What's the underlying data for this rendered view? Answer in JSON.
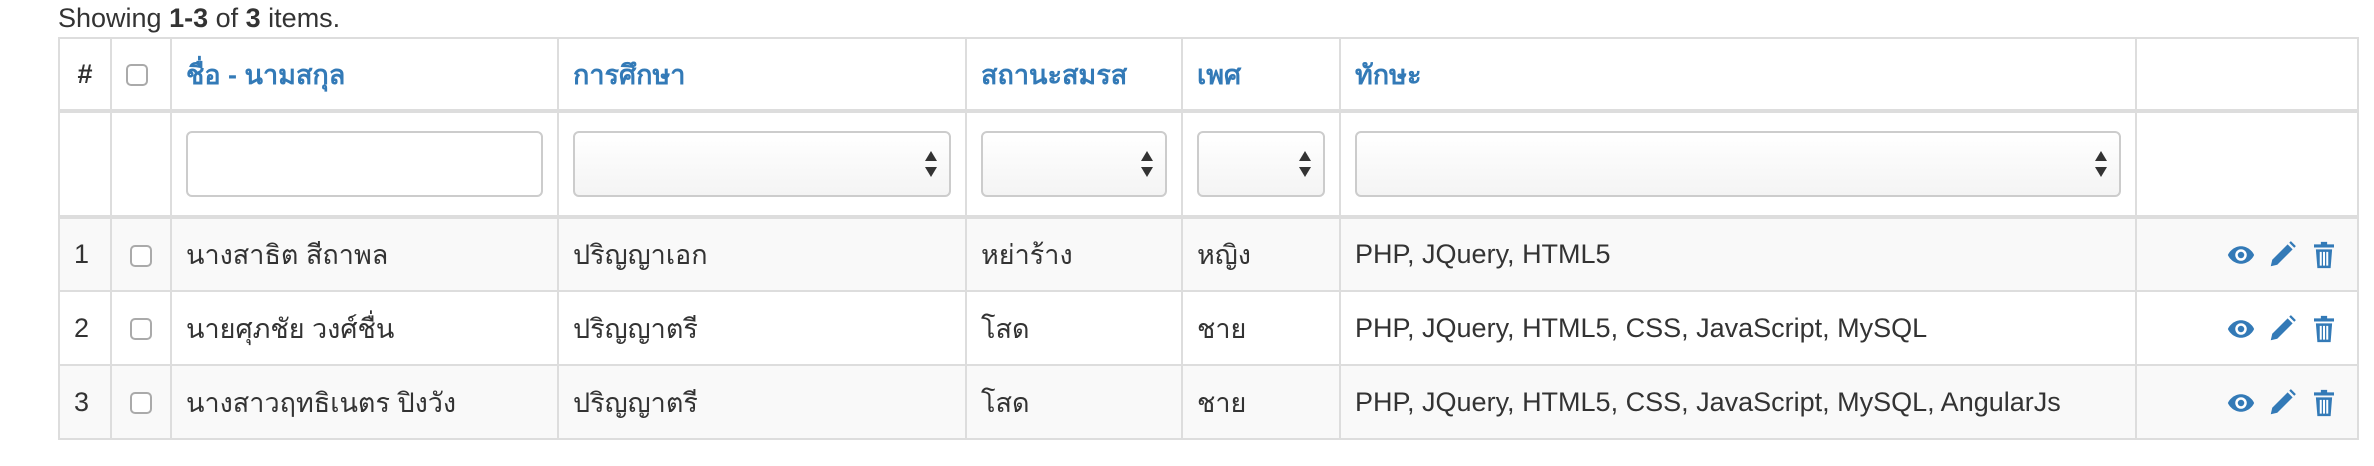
{
  "summary": {
    "prefix": "Showing ",
    "range": "1-3",
    "middle": " of ",
    "total": "3",
    "suffix": " items."
  },
  "columns": {
    "num": "#",
    "name": "ชื่อ - นามสกุล",
    "education": "การศึกษา",
    "marital": "สถานะสมรส",
    "sex": "เพศ",
    "skills": "ทักษะ"
  },
  "filters": {
    "name": "",
    "education": "",
    "marital": "",
    "sex": "",
    "skills": ""
  },
  "rows": [
    {
      "num": "1",
      "name": "นางสาธิต สีถาพล",
      "education": "ปริญญาเอก",
      "marital": "หย่าร้าง",
      "sex": "หญิง",
      "skills": "PHP, JQuery, HTML5"
    },
    {
      "num": "2",
      "name": "นายศุภชัย วงศ์ชื่น",
      "education": "ปริญญาตรี",
      "marital": "โสด",
      "sex": "ชาย",
      "skills": "PHP, JQuery, HTML5, CSS, JavaScript, MySQL"
    },
    {
      "num": "3",
      "name": "นางสาวฤทธิเนตร ปิงวัง",
      "education": "ปริญญาตรี",
      "marital": "โสด",
      "sex": "ชาย",
      "skills": "PHP, JQuery, HTML5, CSS, JavaScript, MySQL, AngularJs"
    }
  ],
  "icons": {
    "view": "eye-icon",
    "edit": "pencil-icon",
    "delete": "trash-icon"
  },
  "colors": {
    "link": "#337ab7",
    "border": "#dddddd",
    "stripe": "#f9f9f9"
  }
}
